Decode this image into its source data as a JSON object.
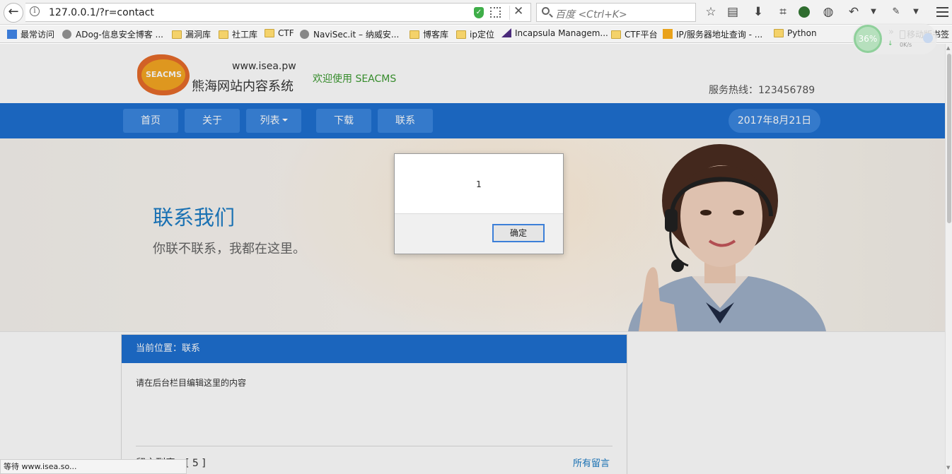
{
  "browser": {
    "url": "127.0.0.1/?r=contact",
    "search_placeholder": "百度 <Ctrl+K>",
    "bookmarks": [
      "最常访问",
      "ADog-信息安全博客 ...",
      "漏洞库",
      "社工库",
      "CTF",
      "NaviSec.it – 纳威安...",
      "博客库",
      "ip定位",
      "Incapsula Managem...",
      "CTF平台",
      "IP/服务器地址查询 - ...",
      "Python"
    ],
    "overflow": "»",
    "mobile_bookmarks": "移动版书签",
    "speed_percent": "36%",
    "speed_rate": "0K/s",
    "status_text": "等待 www.isea.so..."
  },
  "site": {
    "logo_text": "SEACMS",
    "domain": "www.isea.pw",
    "name": "熊海网站内容系统",
    "welcome": "欢迎使用 SEACMS",
    "hotline": "服务热线：123456789"
  },
  "nav": {
    "items": [
      "首页",
      "关于",
      "列表",
      "下载",
      "联系"
    ],
    "date": "2017年8月21日"
  },
  "banner": {
    "title": "联系我们",
    "subtitle": "你联不联系，我都在这里。"
  },
  "content": {
    "breadcrumb": "当前位置：联系",
    "body": "请在后台栏目编辑这里的内容",
    "message_list": "留言列表 - [ 5 ]",
    "all_messages": "所有留言"
  },
  "dialog": {
    "message": "1",
    "ok_label": "确定"
  },
  "colors": {
    "nav_blue": "#1e6fd0",
    "nav_button": "#3b87e0",
    "banner_title": "#1d7dc5",
    "welcome_green": "#3c9a31"
  }
}
